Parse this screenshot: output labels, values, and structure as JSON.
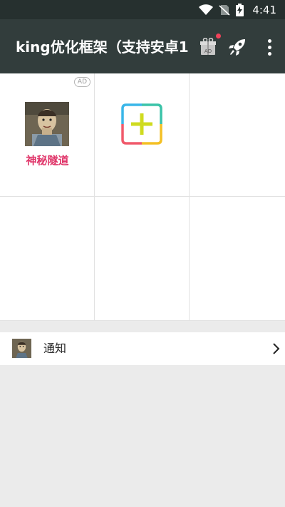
{
  "status_bar": {
    "time": "4:41",
    "icons": [
      "wifi-icon",
      "no-sim-icon",
      "battery-charging-icon"
    ]
  },
  "app_bar": {
    "title": "king优化框架（支持安卓1",
    "ad_badge": "AD",
    "icons": [
      "gift-ad-icon",
      "rocket-icon",
      "more-vert-icon"
    ],
    "dot_color": "#f1425a"
  },
  "grid": {
    "cells": [
      {
        "type": "app",
        "label": "神秘隧道",
        "badge": "AD",
        "label_color": "#e0366a"
      },
      {
        "type": "add",
        "icon": "add-icon"
      },
      {
        "type": "empty"
      },
      {
        "type": "empty"
      },
      {
        "type": "empty"
      },
      {
        "type": "empty"
      }
    ]
  },
  "notice_row": {
    "label": "通知",
    "icon": "chevron-right-icon"
  },
  "colors": {
    "status_bar": "#26302f",
    "app_bar": "#323d3c",
    "background": "#ebebeb",
    "accent_pink": "#e0366a"
  }
}
